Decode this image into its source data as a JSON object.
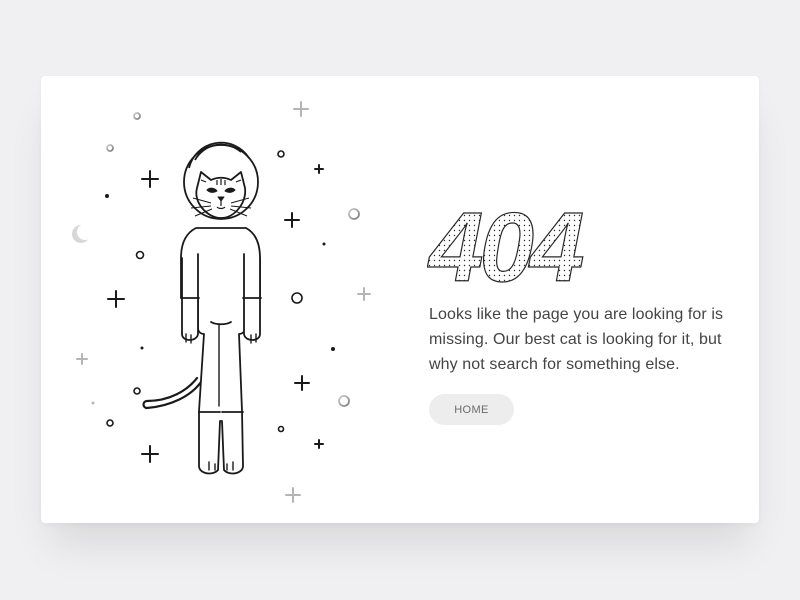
{
  "error": {
    "code": "404",
    "message": "Looks like the page you are looking for is missing. Our best cat is looking for it, but why not search for something else."
  },
  "actions": {
    "home_label": "HOME"
  },
  "illustration": {
    "subject": "astronaut-cat-icon"
  },
  "colors": {
    "background": "#f0f0f2",
    "card": "#ffffff",
    "ink": "#1a1a1a",
    "text": "#444444",
    "button_bg": "#ededed",
    "button_text": "#6b6b6b"
  }
}
